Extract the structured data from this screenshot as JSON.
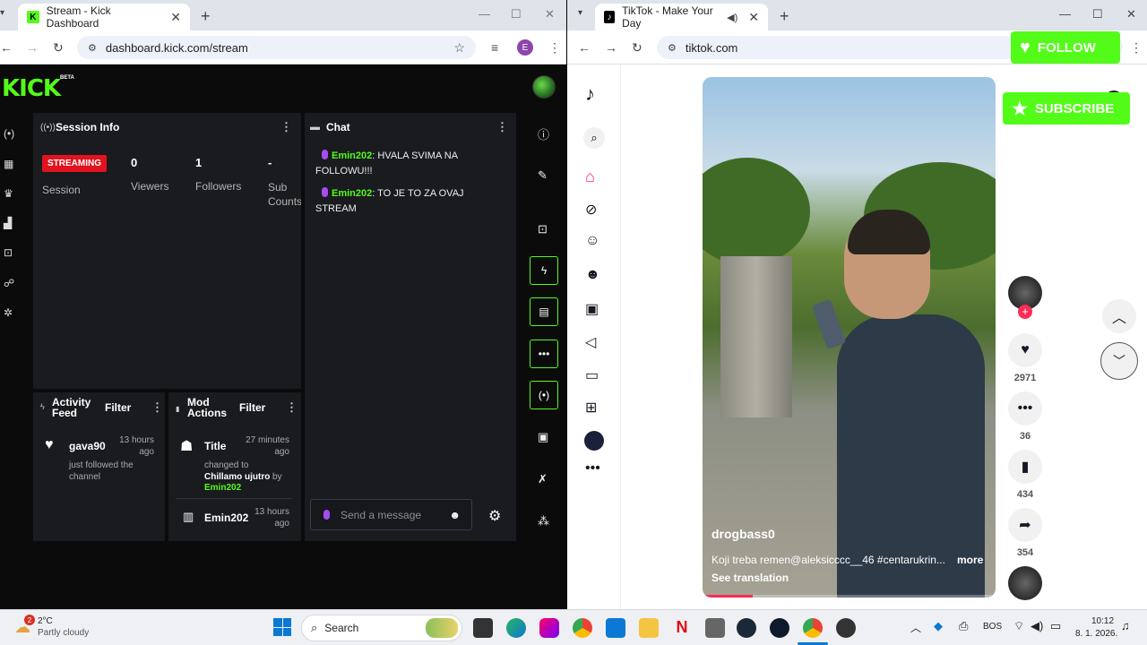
{
  "left_window": {
    "tab_title": "Stream - Kick Dashboard",
    "url": "dashboard.kick.com/stream",
    "profile_initial": "E"
  },
  "kick": {
    "logo": "KICK",
    "logo_badge": "BETA",
    "session": {
      "title": "Session Info",
      "status": "STREAMING",
      "session_label": "Session",
      "viewers": "0",
      "viewers_label": "Viewers",
      "followers": "1",
      "followers_label": "Followers",
      "subs": "-",
      "subs_label": "Sub Counts"
    },
    "chat": {
      "title": "Chat",
      "messages": [
        {
          "user": "Emin202",
          "text": ": HVALA SVIMA NA FOLLOWU!!!"
        },
        {
          "user": "Emin202",
          "text": ": TO JE TO ZA OVAJ STREAM"
        }
      ],
      "input_placeholder": "Send a message"
    },
    "activity": {
      "title": "Activity Feed",
      "filter": "Filter",
      "item_user": "gava90",
      "item_time": "13 hours ago",
      "item_text": "just followed the channel"
    },
    "mod": {
      "title": "Mod Actions",
      "filter": "Filter",
      "item1_title": "Title",
      "item1_time": "27 minutes ago",
      "item1_text": "changed to",
      "item1_value": "Chillamo ujutro",
      "item1_by": "by",
      "item1_user": "Emin202",
      "item2_user": "Emin202",
      "item2_time": "13 hours ago"
    }
  },
  "right_window": {
    "tab_title": "TikTok - Make Your Day",
    "url": "tiktok.com"
  },
  "tiktok": {
    "video": {
      "username": "drogbass0",
      "caption": "Koji treba remen@aleksicccc__46 #centarukrin...",
      "more": "more",
      "translation": "See translation",
      "progress": 0.17
    },
    "actions": {
      "likes": "2971",
      "comments": "36",
      "saves": "434",
      "shares": "354"
    }
  },
  "overlays": {
    "follow": "FOLLOW",
    "subscribe": "SUBSCRIBE"
  },
  "taskbar": {
    "weather_badge": "2",
    "temp": "2°C",
    "weather": "Partly cloudy",
    "search": "Search",
    "lang": "BOS",
    "time": "10:12",
    "date": "8. 1. 2026."
  }
}
